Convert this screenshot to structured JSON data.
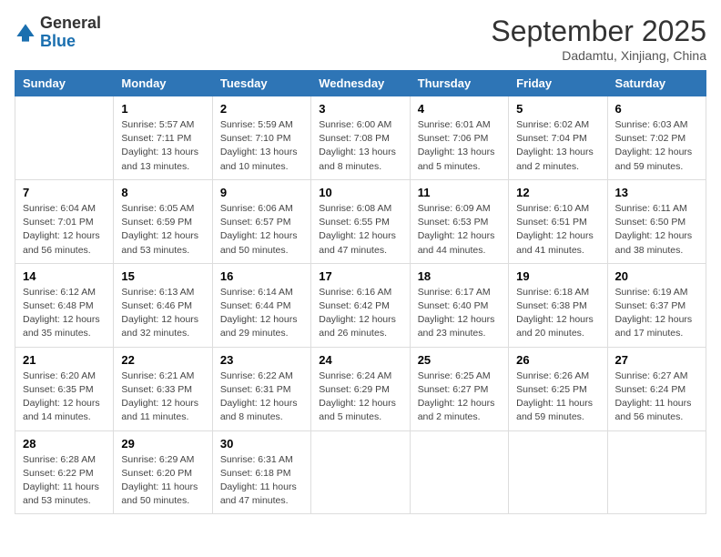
{
  "header": {
    "logo": {
      "general": "General",
      "blue": "Blue",
      "tagline": "General Blue"
    },
    "title": "September 2025",
    "subtitle": "Dadamtu, Xinjiang, China"
  },
  "days_of_week": [
    "Sunday",
    "Monday",
    "Tuesday",
    "Wednesday",
    "Thursday",
    "Friday",
    "Saturday"
  ],
  "weeks": [
    [
      {
        "day": "",
        "content": ""
      },
      {
        "day": "1",
        "content": "Sunrise: 5:57 AM\nSunset: 7:11 PM\nDaylight: 13 hours\nand 13 minutes."
      },
      {
        "day": "2",
        "content": "Sunrise: 5:59 AM\nSunset: 7:10 PM\nDaylight: 13 hours\nand 10 minutes."
      },
      {
        "day": "3",
        "content": "Sunrise: 6:00 AM\nSunset: 7:08 PM\nDaylight: 13 hours\nand 8 minutes."
      },
      {
        "day": "4",
        "content": "Sunrise: 6:01 AM\nSunset: 7:06 PM\nDaylight: 13 hours\nand 5 minutes."
      },
      {
        "day": "5",
        "content": "Sunrise: 6:02 AM\nSunset: 7:04 PM\nDaylight: 13 hours\nand 2 minutes."
      },
      {
        "day": "6",
        "content": "Sunrise: 6:03 AM\nSunset: 7:02 PM\nDaylight: 12 hours\nand 59 minutes."
      }
    ],
    [
      {
        "day": "7",
        "content": "Sunrise: 6:04 AM\nSunset: 7:01 PM\nDaylight: 12 hours\nand 56 minutes."
      },
      {
        "day": "8",
        "content": "Sunrise: 6:05 AM\nSunset: 6:59 PM\nDaylight: 12 hours\nand 53 minutes."
      },
      {
        "day": "9",
        "content": "Sunrise: 6:06 AM\nSunset: 6:57 PM\nDaylight: 12 hours\nand 50 minutes."
      },
      {
        "day": "10",
        "content": "Sunrise: 6:08 AM\nSunset: 6:55 PM\nDaylight: 12 hours\nand 47 minutes."
      },
      {
        "day": "11",
        "content": "Sunrise: 6:09 AM\nSunset: 6:53 PM\nDaylight: 12 hours\nand 44 minutes."
      },
      {
        "day": "12",
        "content": "Sunrise: 6:10 AM\nSunset: 6:51 PM\nDaylight: 12 hours\nand 41 minutes."
      },
      {
        "day": "13",
        "content": "Sunrise: 6:11 AM\nSunset: 6:50 PM\nDaylight: 12 hours\nand 38 minutes."
      }
    ],
    [
      {
        "day": "14",
        "content": "Sunrise: 6:12 AM\nSunset: 6:48 PM\nDaylight: 12 hours\nand 35 minutes."
      },
      {
        "day": "15",
        "content": "Sunrise: 6:13 AM\nSunset: 6:46 PM\nDaylight: 12 hours\nand 32 minutes."
      },
      {
        "day": "16",
        "content": "Sunrise: 6:14 AM\nSunset: 6:44 PM\nDaylight: 12 hours\nand 29 minutes."
      },
      {
        "day": "17",
        "content": "Sunrise: 6:16 AM\nSunset: 6:42 PM\nDaylight: 12 hours\nand 26 minutes."
      },
      {
        "day": "18",
        "content": "Sunrise: 6:17 AM\nSunset: 6:40 PM\nDaylight: 12 hours\nand 23 minutes."
      },
      {
        "day": "19",
        "content": "Sunrise: 6:18 AM\nSunset: 6:38 PM\nDaylight: 12 hours\nand 20 minutes."
      },
      {
        "day": "20",
        "content": "Sunrise: 6:19 AM\nSunset: 6:37 PM\nDaylight: 12 hours\nand 17 minutes."
      }
    ],
    [
      {
        "day": "21",
        "content": "Sunrise: 6:20 AM\nSunset: 6:35 PM\nDaylight: 12 hours\nand 14 minutes."
      },
      {
        "day": "22",
        "content": "Sunrise: 6:21 AM\nSunset: 6:33 PM\nDaylight: 12 hours\nand 11 minutes."
      },
      {
        "day": "23",
        "content": "Sunrise: 6:22 AM\nSunset: 6:31 PM\nDaylight: 12 hours\nand 8 minutes."
      },
      {
        "day": "24",
        "content": "Sunrise: 6:24 AM\nSunset: 6:29 PM\nDaylight: 12 hours\nand 5 minutes."
      },
      {
        "day": "25",
        "content": "Sunrise: 6:25 AM\nSunset: 6:27 PM\nDaylight: 12 hours\nand 2 minutes."
      },
      {
        "day": "26",
        "content": "Sunrise: 6:26 AM\nSunset: 6:25 PM\nDaylight: 11 hours\nand 59 minutes."
      },
      {
        "day": "27",
        "content": "Sunrise: 6:27 AM\nSunset: 6:24 PM\nDaylight: 11 hours\nand 56 minutes."
      }
    ],
    [
      {
        "day": "28",
        "content": "Sunrise: 6:28 AM\nSunset: 6:22 PM\nDaylight: 11 hours\nand 53 minutes."
      },
      {
        "day": "29",
        "content": "Sunrise: 6:29 AM\nSunset: 6:20 PM\nDaylight: 11 hours\nand 50 minutes."
      },
      {
        "day": "30",
        "content": "Sunrise: 6:31 AM\nSunset: 6:18 PM\nDaylight: 11 hours\nand 47 minutes."
      },
      {
        "day": "",
        "content": ""
      },
      {
        "day": "",
        "content": ""
      },
      {
        "day": "",
        "content": ""
      },
      {
        "day": "",
        "content": ""
      }
    ]
  ]
}
